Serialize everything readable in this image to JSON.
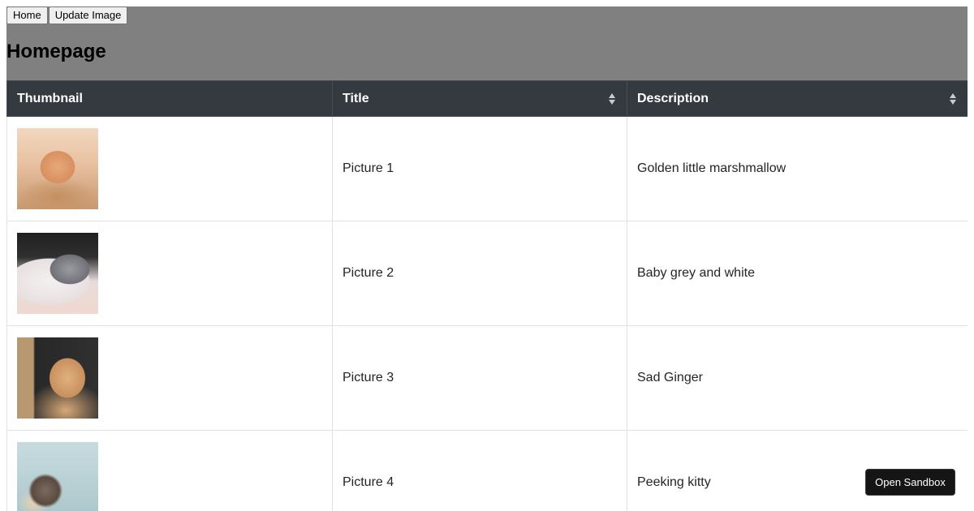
{
  "nav": {
    "home_label": "Home",
    "update_image_label": "Update Image"
  },
  "header": {
    "title": "Homepage",
    "background_color": "#808080"
  },
  "table": {
    "header_color": "#343a40",
    "columns": [
      {
        "label": "Thumbnail",
        "sortable": false
      },
      {
        "label": "Title",
        "sortable": true
      },
      {
        "label": "Description",
        "sortable": true
      }
    ],
    "rows": [
      {
        "thumbnail": "kitten-image",
        "title": "Picture 1",
        "description": "Golden little marshmallow"
      },
      {
        "thumbnail": "kitten-image",
        "title": "Picture 2",
        "description": "Baby grey and white"
      },
      {
        "thumbnail": "cat-image",
        "title": "Picture 3",
        "description": "Sad Ginger"
      },
      {
        "thumbnail": "kitten-image",
        "title": "Picture 4",
        "description": "Peeking kitty"
      }
    ]
  },
  "sandbox": {
    "label": "Open Sandbox"
  }
}
